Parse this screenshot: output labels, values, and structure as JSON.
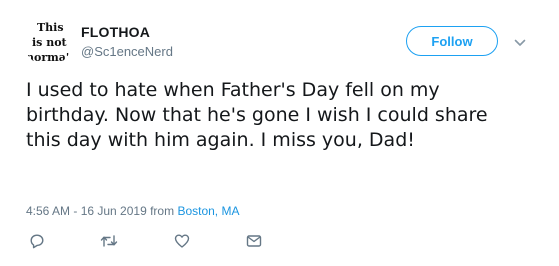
{
  "user": {
    "display_name": "FLOTHOA",
    "handle": "@Sc1enceNerd",
    "avatar_text": [
      "This",
      "is not",
      "norma'"
    ]
  },
  "follow_button": {
    "label": "Follow"
  },
  "tweet": {
    "text": "I used to hate when Father's Day fell on my birthday. Now that he's gone I wish I could share this day with him again. I miss you, Dad!",
    "timestamp": "4:56 AM - 16 Jun 2019",
    "from_prefix": "from",
    "location": "Boston, MA"
  },
  "icons": {
    "menu": "chevron-down-icon",
    "reply": "reply-icon",
    "retweet": "retweet-icon",
    "like": "heart-icon",
    "message": "envelope-icon"
  },
  "colors": {
    "accent": "#1da1f2",
    "secondary_text": "#657786",
    "primary_text": "#14171a",
    "link": "#1b95e0"
  }
}
